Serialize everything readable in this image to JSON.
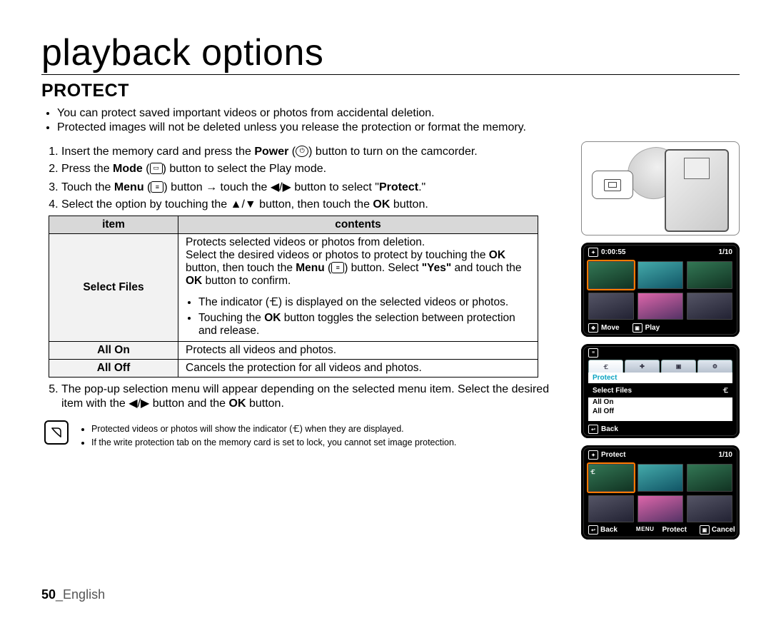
{
  "chapter_title": "playback options",
  "section_heading": "PROTECT",
  "intro_bullets": [
    "You can protect saved important videos or photos from accidental deletion.",
    "Protected images will not be deleted unless you release the protection or format the memory."
  ],
  "steps": {
    "s1_a": "Insert the memory card and press the ",
    "s1_b": "Power",
    "s1_c": " button to turn on the camcorder.",
    "s2_a": "Press the ",
    "s2_b": "Mode",
    "s2_c": " button to select the Play mode.",
    "s3_a": "Touch the ",
    "s3_b": "Menu",
    "s3_c": " button → touch the ◀/▶ button to select \"",
    "s3_d": "Protect",
    "s3_e": ".\"",
    "s4_a": "Select the option by touching the ▲/▼ button, then touch the ",
    "s4_b": "OK",
    "s4_c": " button."
  },
  "table": {
    "header_item": "item",
    "header_contents": "contents",
    "rows": [
      {
        "item": "Select Files",
        "content_intro_1": "Protects selected videos or photos from deletion.",
        "content_intro_2a": "Select the desired videos or photos to protect by touching the ",
        "content_intro_2b": "OK",
        "content_intro_2c": " button, then touch the ",
        "content_intro_2d": "Menu",
        "content_intro_2e": " button. Select ",
        "content_intro_2f": "\"Yes\"",
        "content_intro_2g": " and touch the ",
        "content_intro_2h": "OK",
        "content_intro_2i": " button to confirm.",
        "sub_bullets": [
          "The indicator (🝗) is displayed on the selected videos or photos.",
          "Touching the OK button toggles the selection between protection and release."
        ],
        "sub_bullet_2a": "Touching the ",
        "sub_bullet_2b": "OK",
        "sub_bullet_2c": " button toggles the selection between protection and release."
      },
      {
        "item": "All On",
        "content": "Protects all videos and photos."
      },
      {
        "item": "All Off",
        "content": "Cancels the protection for all videos and photos."
      }
    ]
  },
  "step5_a": "The pop-up selection menu will appear depending on the selected menu item. Select the desired item with the ◀/▶ button and the ",
  "step5_b": "OK",
  "step5_c": " button.",
  "notes": [
    "Protected videos or photos will show the indicator (🝗) when they are displayed.",
    "If the write protection tab on the memory card is set to lock, you cannot set image protection."
  ],
  "footer_page": "50",
  "footer_lang": "_English",
  "screens": {
    "s1": {
      "time": "0:00:55",
      "counter": "1/10",
      "bottom_move": "Move",
      "bottom_play": "Play"
    },
    "s2": {
      "title": "Protect",
      "opt1": "Select Files",
      "opt2": "All On",
      "opt3": "All Off",
      "bottom_back": "Back"
    },
    "s3": {
      "title": "Protect",
      "counter": "1/10",
      "bottom_back": "Back",
      "bottom_protect": "Protect",
      "bottom_cancel": "Cancel",
      "menu_key": "MENU"
    }
  }
}
